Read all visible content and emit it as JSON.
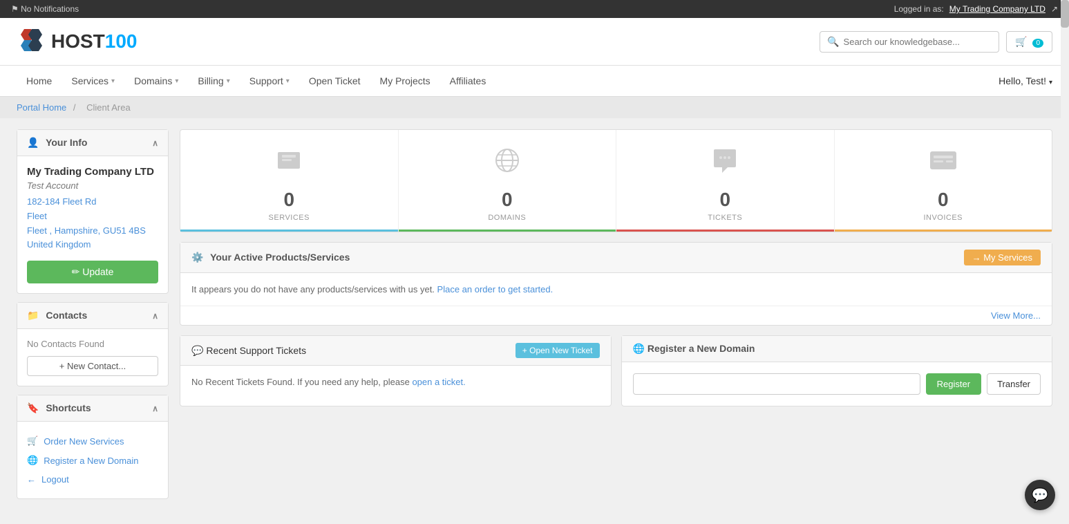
{
  "topbar": {
    "notifications": "No Notifications",
    "logged_in_label": "Logged in as:",
    "company": "My Trading Company LTD",
    "external_icon": "↗"
  },
  "header": {
    "logo_text_host": "HOST",
    "logo_text_100": "100",
    "search_placeholder": "Search our knowledgebase...",
    "cart_count": "0"
  },
  "nav": {
    "items": [
      {
        "label": "Home",
        "has_dropdown": false
      },
      {
        "label": "Services",
        "has_dropdown": true
      },
      {
        "label": "Domains",
        "has_dropdown": true
      },
      {
        "label": "Billing",
        "has_dropdown": true
      },
      {
        "label": "Support",
        "has_dropdown": true
      },
      {
        "label": "Open Ticket",
        "has_dropdown": false
      },
      {
        "label": "My Projects",
        "has_dropdown": false
      },
      {
        "label": "Affiliates",
        "has_dropdown": false
      }
    ],
    "user_greeting": "Hello, Test!"
  },
  "breadcrumb": {
    "portal_home": "Portal Home",
    "separator": "/",
    "client_area": "Client Area"
  },
  "stats": [
    {
      "number": "0",
      "label": "SERVICES",
      "bar_class": "blue"
    },
    {
      "number": "0",
      "label": "DOMAINS",
      "bar_class": "green"
    },
    {
      "number": "0",
      "label": "TICKETS",
      "bar_class": "red"
    },
    {
      "number": "0",
      "label": "INVOICES",
      "bar_class": "orange"
    }
  ],
  "sidebar": {
    "your_info": {
      "title": "Your Info",
      "company_name": "My Trading Company LTD",
      "account_type": "Test Account",
      "address1": "182-184 Fleet Rd",
      "address2": "Fleet",
      "address3": "Fleet , Hampshire, GU51 4BS",
      "country": "United Kingdom",
      "update_btn": "✏ Update"
    },
    "contacts": {
      "title": "Contacts",
      "empty_text": "No Contacts Found",
      "new_contact_btn": "+ New Contact..."
    },
    "shortcuts": {
      "title": "Shortcuts",
      "items": [
        {
          "icon": "🛒",
          "label": "Order New Services"
        },
        {
          "icon": "🌐",
          "label": "Register a New Domain"
        },
        {
          "icon": "←",
          "label": "Logout"
        }
      ]
    }
  },
  "active_services": {
    "title": "Your Active Products/Services",
    "my_services_btn": "→ My Services",
    "empty_message": "It appears you do not have any products/services with us yet.",
    "order_link": "Place an order to get started.",
    "view_more": "View More..."
  },
  "support_tickets": {
    "title": "Recent Support Tickets",
    "open_ticket_btn": "+ Open New Ticket",
    "empty_message": "No Recent Tickets Found. If you need any help, please",
    "open_link": "open a ticket."
  },
  "domain_register": {
    "title": "Register a New Domain",
    "input_placeholder": "",
    "register_btn": "Register",
    "transfer_btn": "Transfer"
  }
}
